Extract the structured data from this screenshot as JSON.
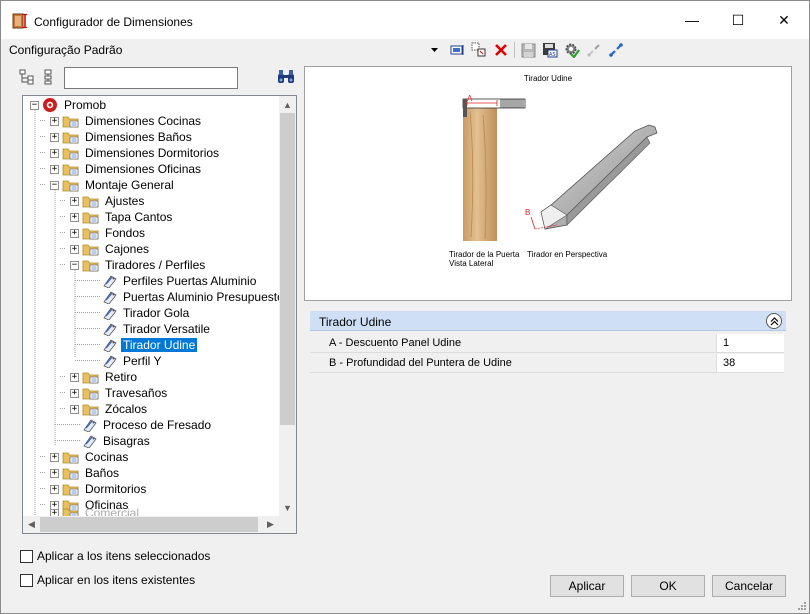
{
  "window": {
    "title": "Configurador de Dimensiones",
    "minimize_glyph": "—",
    "maximize_glyph": "☐",
    "close_glyph": "✕"
  },
  "config_label": "Configuração Padrão",
  "search": {
    "value": "",
    "placeholder": ""
  },
  "tree": {
    "root": "Promob",
    "nodes": {
      "n1": "Dimensiones Cocinas",
      "n2": "Dimensiones Baños",
      "n3": "Dimensiones Dormitorios",
      "n4": "Dimensiones Oficinas",
      "n5": "Montaje General",
      "n6": "Ajustes",
      "n7": "Tapa Cantos",
      "n8": "Fondos",
      "n9": "Cajones",
      "n10": "Tiradores / Perfiles",
      "n11": "Perfiles Puertas Aluminio",
      "n12": "Puertas Aluminio Presupuesto",
      "n13": "Tirador Gola",
      "n14": "Tirador Versatile",
      "n15": "Tirador Udine",
      "n16": "Perfil Y",
      "n17": "Retiro",
      "n18": "Travesaños",
      "n19": "Zócalos",
      "n20": "Proceso de Fresado",
      "n21": "Bisagras",
      "n22": "Cocinas",
      "n23": "Baños",
      "n24": "Dormitorios",
      "n25": "Oficinas",
      "n26": "Comercial"
    },
    "selected": "Tirador Udine"
  },
  "preview": {
    "title": "Tirador Udine",
    "caption_left_1": "Tirador de la Puerta",
    "caption_left_2": "Vista Lateral",
    "caption_right": "Tirador en Perspectiva",
    "label_a": "A",
    "label_b": "B"
  },
  "properties": {
    "group_title": "Tirador Udine",
    "rows": [
      {
        "name": "A - Descuento Panel Udine",
        "value": "1"
      },
      {
        "name": "B - Profundidad del Puntera de Udine",
        "value": "38"
      }
    ]
  },
  "options": {
    "apply_selected": "Aplicar a los itens seleccionados",
    "apply_existing": "Aplicar en los itens existentes"
  },
  "buttons": {
    "apply": "Aplicar",
    "ok": "OK",
    "cancel": "Cancelar"
  },
  "colors": {
    "selection": "#0078d7",
    "group_header": "#cfe0f6",
    "folder": "#e8c060",
    "wood": "#d8b07a",
    "profile": "#a8a8a8"
  }
}
